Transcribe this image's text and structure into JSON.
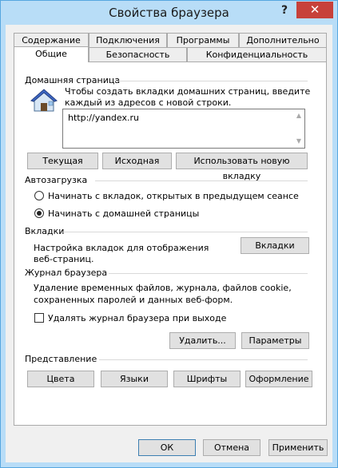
{
  "window": {
    "title": "Свойства браузера",
    "help": "?",
    "close": "✕"
  },
  "tabs_back": [
    "Содержание",
    "Подключения",
    "Программы",
    "Дополнительно"
  ],
  "tabs_front": [
    "Общие",
    "Безопасность",
    "Конфиденциальность"
  ],
  "home": {
    "group": "Домашняя страница",
    "desc1": "Чтобы создать вкладки домашних страниц, введите",
    "desc2": "каждый из адресов с новой строки.",
    "url": "http://yandex.ru",
    "btn_current": "Текущая",
    "btn_default": "Исходная",
    "btn_newtab": "Использовать новую вкладку"
  },
  "startup": {
    "group": "Автозагрузка",
    "opt1": "Начинать с вкладок, открытых в предыдущем сеансе",
    "opt2": "Начинать с домашней страницы",
    "selected": 2
  },
  "tabsgrp": {
    "group": "Вкладки",
    "desc1": "Настройка вкладок для отображения",
    "desc2": "веб-страниц.",
    "btn": "Вкладки"
  },
  "history": {
    "group": "Журнал браузера",
    "desc1": "Удаление временных файлов, журнала, файлов cookie,",
    "desc2": "сохраненных паролей и данных веб-форм.",
    "check": "Удалять журнал браузера при выходе",
    "checked": false,
    "btn_delete": "Удалить...",
    "btn_settings": "Параметры"
  },
  "appearance": {
    "group": "Представление",
    "btn_colors": "Цвета",
    "btn_langs": "Языки",
    "btn_fonts": "Шрифты",
    "btn_access": "Оформление"
  },
  "footer": {
    "ok": "ОК",
    "cancel": "Отмена",
    "apply": "Применить"
  }
}
